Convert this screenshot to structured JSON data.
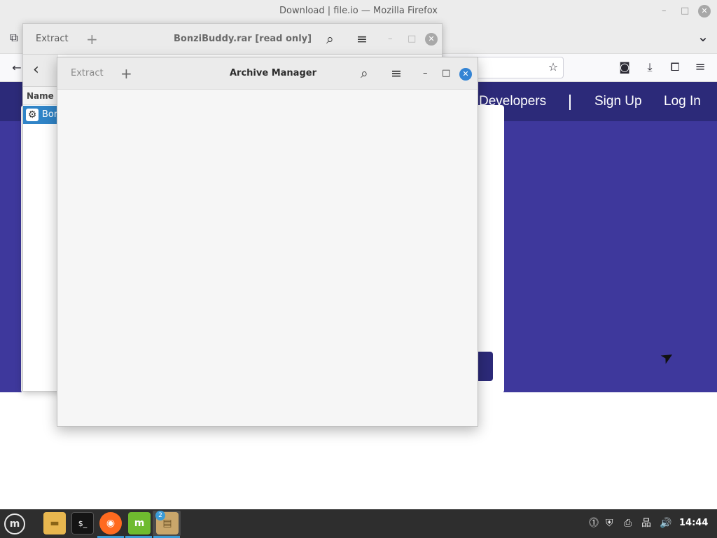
{
  "firefox": {
    "window_title": "Download | file.io — Mozilla Firefox",
    "minimize": "–",
    "maximize": "□",
    "close": "✕",
    "back_icon": "←",
    "tabs_icon": "⧉",
    "dropdown_icon": "⌄",
    "star_icon": "☆",
    "pocket_icon": "◙",
    "download_icon": "⤓",
    "extensions_icon": "⧠",
    "menu_icon": "≡"
  },
  "site": {
    "nav": [
      "Developers",
      "Sign Up",
      "Log In"
    ],
    "colors": {
      "header": "#2c2a79",
      "hero": "#3e389c"
    }
  },
  "back_window": {
    "extract_label": "Extract",
    "add_icon": "+",
    "title": "BonziBuddy.rar [read only]",
    "search_icon": "⌕",
    "menu_icon": "≡",
    "minimize": "–",
    "maximize": "□",
    "close": "✕",
    "back_icon": "‹",
    "column_header": "Name",
    "row_label": "Bon"
  },
  "front_window": {
    "extract_label": "Extract",
    "add_icon": "+",
    "title": "Archive Manager",
    "search_icon": "⌕",
    "menu_icon": "≡",
    "minimize": "–",
    "maximize": "□",
    "close": "✕"
  },
  "taskbar": {
    "menu_icon": "m",
    "apps": [
      {
        "name": "files-icon",
        "glyph": "▬"
      },
      {
        "name": "terminal-icon",
        "glyph": "$_"
      },
      {
        "name": "firefox-icon",
        "glyph": "◉"
      },
      {
        "name": "mintinstall-icon",
        "glyph": "m"
      },
      {
        "name": "archive-manager-icon",
        "glyph": "▤"
      }
    ],
    "archive_badge": "2",
    "tray": [
      "⓵",
      "⛨",
      "⎙",
      "品",
      "🔊"
    ],
    "clock": "14:44"
  },
  "cursor_icon": "➤"
}
